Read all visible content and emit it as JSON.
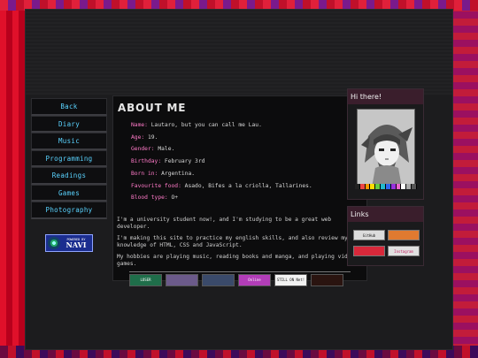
{
  "nav": {
    "items": [
      "Back",
      "Diary",
      "Music",
      "Programming",
      "Readings",
      "Games",
      "Photography"
    ]
  },
  "badge": {
    "small": "POWERED BY",
    "big": "NAVI"
  },
  "main": {
    "title": "ABOUT ME",
    "facts": [
      {
        "k": "Name:",
        "v": " Lautaro, but you can call me Lau."
      },
      {
        "k": "Age:",
        "v": " 19."
      },
      {
        "k": "Gender:",
        "v": " Male."
      },
      {
        "k": "Birthday:",
        "v": " February 3rd"
      },
      {
        "k": "Born in:",
        "v": " Argentina."
      },
      {
        "k": "Favourite food:",
        "v": " Asado, Bifes a la criolla, Tallarines."
      },
      {
        "k": "Blood type:",
        "v": " O+"
      }
    ],
    "p1": "I'm a university student now!, and I'm studying to be a great web developer.",
    "p2": "I'm making this site to practice my english skills, and also review my knowledge of HTML, CSS and JavaScript.",
    "p3": "My hobbies are playing music, reading books and manga, and playing video games.",
    "buttons": [
      {
        "label": "LOSER",
        "color": "#1f6e4a"
      },
      {
        "label": "",
        "color": "#6b5a8a"
      },
      {
        "label": "",
        "color": "#3a4a6a"
      },
      {
        "label": "Online",
        "color": "#b23db8"
      },
      {
        "label": "STILL ON Net!",
        "color": "#f2f2f2"
      },
      {
        "label": "",
        "color": "#2a1410"
      }
    ]
  },
  "hi": {
    "title": "Hi there!"
  },
  "links": {
    "title": "Links",
    "items": [
      {
        "label": "GitHub",
        "color": "#dcdcdc",
        "text_color": "#111111"
      },
      {
        "label": "",
        "color": "#e07a30",
        "text_color": "#ffffff"
      },
      {
        "label": "",
        "color": "#d8283a",
        "text_color": "#ffffff"
      },
      {
        "label": "Instagram",
        "color": "#e0e0e0",
        "text_color": "#c02060"
      }
    ]
  },
  "colors": {
    "accent_link": "#5ad3ff",
    "label_pink": "#ff7ac8"
  }
}
